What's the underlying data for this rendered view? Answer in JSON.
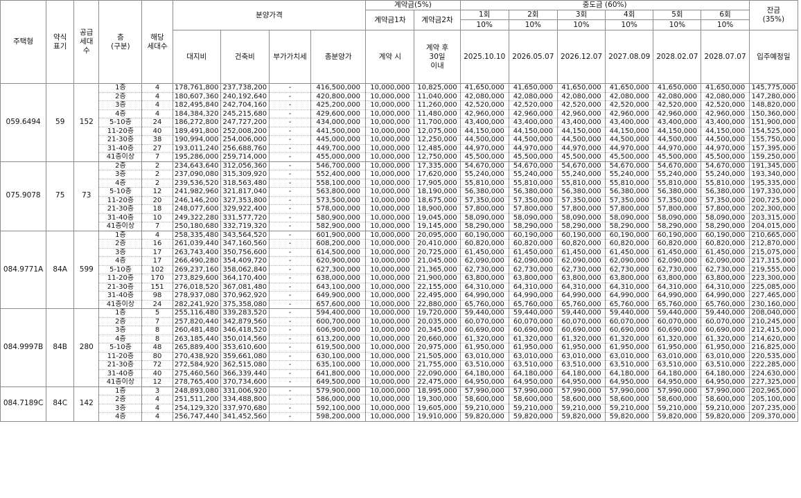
{
  "header": {
    "type_label": "주택형",
    "abbr_label": "약식\n표기",
    "supply_label": "공급\n세대\n수",
    "floor_label": "층\n(구분)",
    "units_label": "해당\n세대수",
    "price_group": "분양가격",
    "land": "대지비",
    "building": "건축비",
    "vat": "부가가치세",
    "total": "총분양가",
    "deposit_group": "계약금(5%)",
    "dep1": "계약금1차",
    "dep2": "계약금2차",
    "dep1_when": "계약 시",
    "dep2_when": "계약 후\n30일\n이내",
    "middle_group": "중도금 (60%)",
    "middle_rounds": [
      "1회",
      "2회",
      "3회",
      "4회",
      "5회",
      "6회"
    ],
    "middle_pct": [
      "10%",
      "10%",
      "10%",
      "10%",
      "10%",
      "10%"
    ],
    "middle_dates": [
      "2025.10.10",
      "2026.05.07",
      "2026.12.07",
      "2027.08.09",
      "2028.02.07",
      "2028.07.07"
    ],
    "balance_label": "잔금\n(35%)",
    "balance_when": "입주예정일"
  },
  "groups": [
    {
      "type": "059.6494",
      "abbr": "59",
      "supply": "152",
      "rows": [
        [
          "1층",
          "4",
          "178,761,800",
          "237,738,200",
          "-",
          "416,500,000",
          "10,000,000",
          "10,825,000",
          "41,650,000",
          "41,650,000",
          "41,650,000",
          "41,650,000",
          "41,650,000",
          "41,650,000",
          "145,775,000"
        ],
        [
          "2층",
          "4",
          "180,607,360",
          "240,192,640",
          "-",
          "420,800,000",
          "10,000,000",
          "11,040,000",
          "42,080,000",
          "42,080,000",
          "42,080,000",
          "42,080,000",
          "42,080,000",
          "42,080,000",
          "147,280,000"
        ],
        [
          "3층",
          "4",
          "182,495,840",
          "242,704,160",
          "-",
          "425,200,000",
          "10,000,000",
          "11,260,000",
          "42,520,000",
          "42,520,000",
          "42,520,000",
          "42,520,000",
          "42,520,000",
          "42,520,000",
          "148,820,000"
        ],
        [
          "4층",
          "4",
          "184,384,320",
          "245,215,680",
          "-",
          "429,600,000",
          "10,000,000",
          "11,480,000",
          "42,960,000",
          "42,960,000",
          "42,960,000",
          "42,960,000",
          "42,960,000",
          "42,960,000",
          "150,360,000"
        ],
        [
          "5-10층",
          "24",
          "186,272,800",
          "247,727,200",
          "-",
          "434,000,000",
          "10,000,000",
          "11,700,000",
          "43,400,000",
          "43,400,000",
          "43,400,000",
          "43,400,000",
          "43,400,000",
          "43,400,000",
          "151,900,000"
        ],
        [
          "11-20층",
          "40",
          "189,491,800",
          "252,008,200",
          "-",
          "441,500,000",
          "10,000,000",
          "12,075,000",
          "44,150,000",
          "44,150,000",
          "44,150,000",
          "44,150,000",
          "44,150,000",
          "44,150,000",
          "154,525,000"
        ],
        [
          "21-30층",
          "38",
          "190,994,000",
          "254,006,000",
          "-",
          "445,000,000",
          "10,000,000",
          "12,250,000",
          "44,500,000",
          "44,500,000",
          "44,500,000",
          "44,500,000",
          "44,500,000",
          "44,500,000",
          "155,750,000"
        ],
        [
          "31-40층",
          "27",
          "193,011,240",
          "256,688,760",
          "-",
          "449,700,000",
          "10,000,000",
          "12,485,000",
          "44,970,000",
          "44,970,000",
          "44,970,000",
          "44,970,000",
          "44,970,000",
          "44,970,000",
          "157,395,000"
        ],
        [
          "41층이상",
          "7",
          "195,286,000",
          "259,714,000",
          "-",
          "455,000,000",
          "10,000,000",
          "12,750,000",
          "45,500,000",
          "45,500,000",
          "45,500,000",
          "45,500,000",
          "45,500,000",
          "45,500,000",
          "159,250,000"
        ]
      ]
    },
    {
      "type": "075.9078",
      "abbr": "75",
      "supply": "73",
      "rows": [
        [
          "2층",
          "2",
          "234,643,640",
          "312,056,360",
          "-",
          "546,700,000",
          "10,000,000",
          "17,335,000",
          "54,670,000",
          "54,670,000",
          "54,670,000",
          "54,670,000",
          "54,670,000",
          "54,670,000",
          "191,345,000"
        ],
        [
          "3층",
          "2",
          "237,090,080",
          "315,309,920",
          "-",
          "552,400,000",
          "10,000,000",
          "17,620,000",
          "55,240,000",
          "55,240,000",
          "55,240,000",
          "55,240,000",
          "55,240,000",
          "55,240,000",
          "193,340,000"
        ],
        [
          "4층",
          "2",
          "239,536,520",
          "318,563,480",
          "-",
          "558,100,000",
          "10,000,000",
          "17,905,000",
          "55,810,000",
          "55,810,000",
          "55,810,000",
          "55,810,000",
          "55,810,000",
          "55,810,000",
          "195,335,000"
        ],
        [
          "5-10층",
          "12",
          "241,982,960",
          "321,817,040",
          "-",
          "563,800,000",
          "10,000,000",
          "18,190,000",
          "56,380,000",
          "56,380,000",
          "56,380,000",
          "56,380,000",
          "56,380,000",
          "56,380,000",
          "197,330,000"
        ],
        [
          "11-20층",
          "20",
          "246,146,200",
          "327,353,800",
          "-",
          "573,500,000",
          "10,000,000",
          "18,675,000",
          "57,350,000",
          "57,350,000",
          "57,350,000",
          "57,350,000",
          "57,350,000",
          "57,350,000",
          "200,725,000"
        ],
        [
          "21-30층",
          "18",
          "248,077,600",
          "329,922,400",
          "-",
          "578,000,000",
          "10,000,000",
          "18,900,000",
          "57,800,000",
          "57,800,000",
          "57,800,000",
          "57,800,000",
          "57,800,000",
          "57,800,000",
          "202,300,000"
        ],
        [
          "31-40층",
          "10",
          "249,322,280",
          "331,577,720",
          "-",
          "580,900,000",
          "10,000,000",
          "19,045,000",
          "58,090,000",
          "58,090,000",
          "58,090,000",
          "58,090,000",
          "58,090,000",
          "58,090,000",
          "203,315,000"
        ],
        [
          "41층이상",
          "7",
          "250,180,680",
          "332,719,320",
          "-",
          "582,900,000",
          "10,000,000",
          "19,145,000",
          "58,290,000",
          "58,290,000",
          "58,290,000",
          "58,290,000",
          "58,290,000",
          "58,290,000",
          "204,015,000"
        ]
      ]
    },
    {
      "type": "084.9771A",
      "abbr": "84A",
      "supply": "599",
      "rows": [
        [
          "1층",
          "4",
          "258,335,480",
          "343,564,520",
          "-",
          "601,900,000",
          "10,000,000",
          "20,095,000",
          "60,190,000",
          "60,190,000",
          "60,190,000",
          "60,190,000",
          "60,190,000",
          "60,190,000",
          "210,665,000"
        ],
        [
          "2층",
          "16",
          "261,039,440",
          "347,160,560",
          "-",
          "608,200,000",
          "10,000,000",
          "20,410,000",
          "60,820,000",
          "60,820,000",
          "60,820,000",
          "60,820,000",
          "60,820,000",
          "60,820,000",
          "212,870,000"
        ],
        [
          "3층",
          "17",
          "263,743,400",
          "350,756,600",
          "-",
          "614,500,000",
          "10,000,000",
          "20,725,000",
          "61,450,000",
          "61,450,000",
          "61,450,000",
          "61,450,000",
          "61,450,000",
          "61,450,000",
          "215,075,000"
        ],
        [
          "4층",
          "17",
          "266,490,280",
          "354,409,720",
          "-",
          "620,900,000",
          "10,000,000",
          "21,045,000",
          "62,090,000",
          "62,090,000",
          "62,090,000",
          "62,090,000",
          "62,090,000",
          "62,090,000",
          "217,315,000"
        ],
        [
          "5-10층",
          "102",
          "269,237,160",
          "358,062,840",
          "-",
          "627,300,000",
          "10,000,000",
          "21,365,000",
          "62,730,000",
          "62,730,000",
          "62,730,000",
          "62,730,000",
          "62,730,000",
          "62,730,000",
          "219,555,000"
        ],
        [
          "11-20층",
          "170",
          "273,829,600",
          "364,170,400",
          "-",
          "638,000,000",
          "10,000,000",
          "21,900,000",
          "63,800,000",
          "63,800,000",
          "63,800,000",
          "63,800,000",
          "63,800,000",
          "63,800,000",
          "223,300,000"
        ],
        [
          "21-30층",
          "151",
          "276,018,520",
          "367,081,480",
          "-",
          "643,100,000",
          "10,000,000",
          "22,155,000",
          "64,310,000",
          "64,310,000",
          "64,310,000",
          "64,310,000",
          "64,310,000",
          "64,310,000",
          "225,085,000"
        ],
        [
          "31-40층",
          "98",
          "278,937,080",
          "370,962,920",
          "-",
          "649,900,000",
          "10,000,000",
          "22,495,000",
          "64,990,000",
          "64,990,000",
          "64,990,000",
          "64,990,000",
          "64,990,000",
          "64,990,000",
          "227,465,000"
        ],
        [
          "41층이상",
          "24",
          "282,241,920",
          "375,358,080",
          "-",
          "657,600,000",
          "10,000,000",
          "22,880,000",
          "65,760,000",
          "65,760,000",
          "65,760,000",
          "65,760,000",
          "65,760,000",
          "65,760,000",
          "230,160,000"
        ]
      ]
    },
    {
      "type": "084.9997B",
      "abbr": "84B",
      "supply": "280",
      "rows": [
        [
          "1층",
          "5",
          "255,116,480",
          "339,283,520",
          "-",
          "594,400,000",
          "10,000,000",
          "19,720,000",
          "59,440,000",
          "59,440,000",
          "59,440,000",
          "59,440,000",
          "59,440,000",
          "59,440,000",
          "208,040,000"
        ],
        [
          "2층",
          "7",
          "257,820,440",
          "342,879,560",
          "-",
          "600,700,000",
          "10,000,000",
          "20,035,000",
          "60,070,000",
          "60,070,000",
          "60,070,000",
          "60,070,000",
          "60,070,000",
          "60,070,000",
          "210,245,000"
        ],
        [
          "3층",
          "8",
          "260,481,480",
          "346,418,520",
          "-",
          "606,900,000",
          "10,000,000",
          "20,345,000",
          "60,690,000",
          "60,690,000",
          "60,690,000",
          "60,690,000",
          "60,690,000",
          "60,690,000",
          "212,415,000"
        ],
        [
          "4층",
          "8",
          "263,185,440",
          "350,014,560",
          "-",
          "613,200,000",
          "10,000,000",
          "20,660,000",
          "61,320,000",
          "61,320,000",
          "61,320,000",
          "61,320,000",
          "61,320,000",
          "61,320,000",
          "214,620,000"
        ],
        [
          "5-10층",
          "48",
          "265,889,400",
          "353,610,600",
          "-",
          "619,500,000",
          "10,000,000",
          "20,975,000",
          "61,950,000",
          "61,950,000",
          "61,950,000",
          "61,950,000",
          "61,950,000",
          "61,950,000",
          "216,825,000"
        ],
        [
          "11-20층",
          "80",
          "270,438,920",
          "359,661,080",
          "-",
          "630,100,000",
          "10,000,000",
          "21,505,000",
          "63,010,000",
          "63,010,000",
          "63,010,000",
          "63,010,000",
          "63,010,000",
          "63,010,000",
          "220,535,000"
        ],
        [
          "21-30층",
          "72",
          "272,584,920",
          "362,515,080",
          "-",
          "635,100,000",
          "10,000,000",
          "21,755,000",
          "63,510,000",
          "63,510,000",
          "63,510,000",
          "63,510,000",
          "63,510,000",
          "63,510,000",
          "222,285,000"
        ],
        [
          "31-40층",
          "40",
          "275,460,560",
          "366,339,440",
          "-",
          "641,800,000",
          "10,000,000",
          "22,090,000",
          "64,180,000",
          "64,180,000",
          "64,180,000",
          "64,180,000",
          "64,180,000",
          "64,180,000",
          "224,630,000"
        ],
        [
          "41층이상",
          "12",
          "278,765,400",
          "370,734,600",
          "-",
          "649,500,000",
          "10,000,000",
          "22,475,000",
          "64,950,000",
          "64,950,000",
          "64,950,000",
          "64,950,000",
          "64,950,000",
          "64,950,000",
          "227,325,000"
        ]
      ]
    },
    {
      "type": "084.7189C",
      "abbr": "84C",
      "supply": "142",
      "rows": [
        [
          "1층",
          "3",
          "248,893,080",
          "331,006,920",
          "-",
          "579,900,000",
          "10,000,000",
          "18,995,000",
          "57,990,000",
          "57,990,000",
          "57,990,000",
          "57,990,000",
          "57,990,000",
          "57,990,000",
          "202,965,000"
        ],
        [
          "2층",
          "4",
          "251,511,200",
          "334,488,800",
          "-",
          "586,000,000",
          "10,000,000",
          "19,300,000",
          "58,600,000",
          "58,600,000",
          "58,600,000",
          "58,600,000",
          "58,600,000",
          "58,600,000",
          "205,100,000"
        ],
        [
          "3층",
          "4",
          "254,129,320",
          "337,970,680",
          "-",
          "592,100,000",
          "10,000,000",
          "19,605,000",
          "59,210,000",
          "59,210,000",
          "59,210,000",
          "59,210,000",
          "59,210,000",
          "59,210,000",
          "207,235,000"
        ],
        [
          "4층",
          "4",
          "256,747,440",
          "341,452,560",
          "-",
          "598,200,000",
          "10,000,000",
          "19,910,000",
          "59,820,000",
          "59,820,000",
          "59,820,000",
          "59,820,000",
          "59,820,000",
          "59,820,000",
          "209,370,000"
        ]
      ]
    }
  ]
}
